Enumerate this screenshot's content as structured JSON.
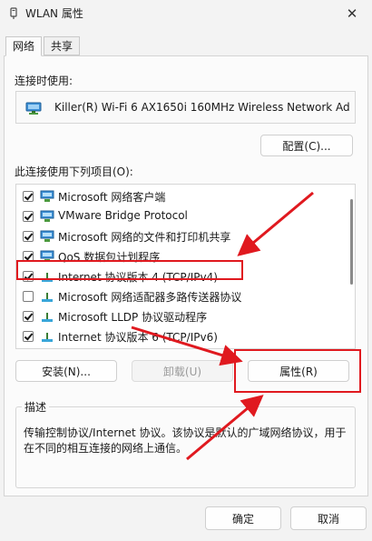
{
  "window": {
    "title": "WLAN 属性",
    "close_glyph": "✕"
  },
  "tabs": [
    {
      "label": "网络",
      "active": true
    },
    {
      "label": "共享",
      "active": false
    }
  ],
  "connect_using": {
    "label": "连接时使用:",
    "adapter": "Killer(R) Wi-Fi 6 AX1650i 160MHz Wireless Network Ad"
  },
  "configure_button": "配置(C)...",
  "components": {
    "label": "此连接使用下列项目(O):",
    "items": [
      {
        "label": "Microsoft 网络客户端",
        "checked": true,
        "icon": "network-client-icon"
      },
      {
        "label": "VMware Bridge Protocol",
        "checked": true,
        "icon": "network-client-icon"
      },
      {
        "label": "Microsoft 网络的文件和打印机共享",
        "checked": true,
        "icon": "network-client-icon"
      },
      {
        "label": "QoS 数据包计划程序",
        "checked": true,
        "icon": "network-client-icon"
      },
      {
        "label": "Internet 协议版本 4 (TCP/IPv4)",
        "checked": true,
        "icon": "protocol-icon"
      },
      {
        "label": "Microsoft 网络适配器多路传送器协议",
        "checked": false,
        "icon": "protocol-icon"
      },
      {
        "label": "Microsoft LLDP 协议驱动程序",
        "checked": true,
        "icon": "protocol-icon"
      },
      {
        "label": "Internet 协议版本 6 (TCP/IPv6)",
        "checked": true,
        "icon": "protocol-icon"
      }
    ]
  },
  "actions": {
    "install": "安装(N)...",
    "uninstall": "卸载(U)",
    "properties": "属性(R)"
  },
  "description": {
    "title": "描述",
    "text": "传输控制协议/Internet 协议。该协议是默认的广域网络协议，用于在不同的相互连接的网络上通信。"
  },
  "footer": {
    "ok": "确定",
    "cancel": "取消"
  },
  "annotation_color": "#e0191f"
}
